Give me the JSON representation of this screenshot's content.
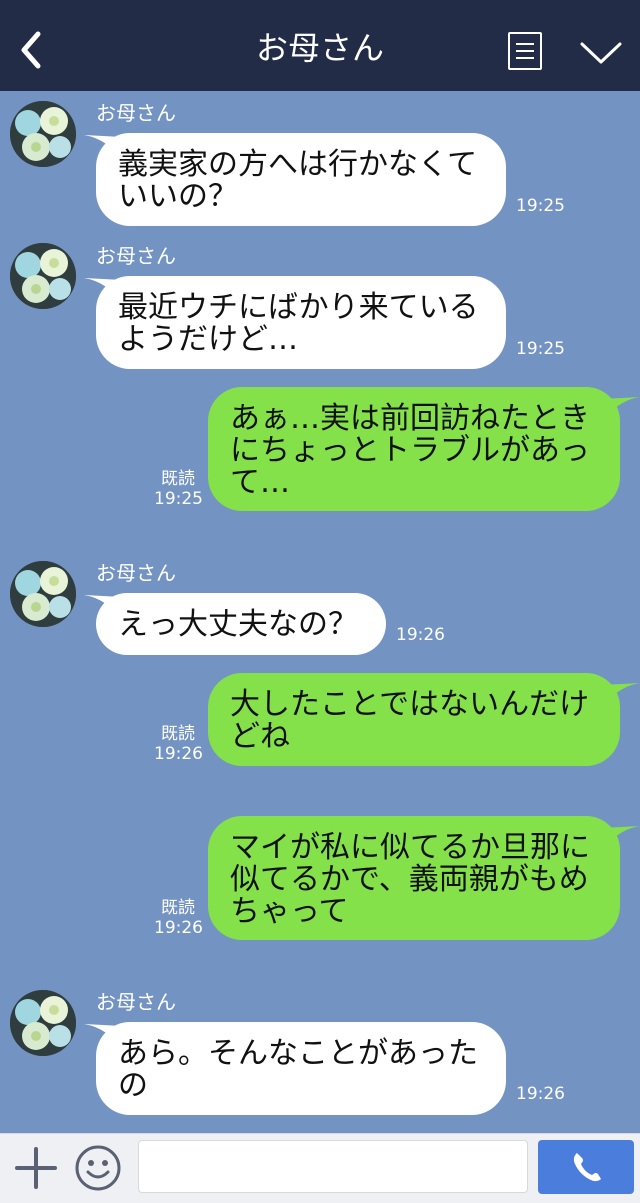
{
  "header": {
    "title": "お母さん"
  },
  "messages": [
    {
      "type": "in",
      "sender": "お母さん",
      "lines": [
        "義実家の方へは行かなくて",
        "いいの？"
      ],
      "time": "19:25"
    },
    {
      "type": "in",
      "sender": "お母さん",
      "lines": [
        "最近ウチにばかり来ている",
        "ようだけど…"
      ],
      "time": "19:25"
    },
    {
      "type": "out",
      "lines": [
        "あぁ…実は前回訪ねたとき",
        "にちょっとトラブルがあっ",
        "て…"
      ],
      "read": "既読",
      "time": "19:25"
    },
    {
      "type": "in",
      "sender": "お母さん",
      "lines": [
        "えっ大丈夫なの？"
      ],
      "time": "19:26"
    },
    {
      "type": "out",
      "lines": [
        "大したことではないんだけ",
        "どね"
      ],
      "read": "既読",
      "time": "19:26"
    },
    {
      "type": "out",
      "lines": [
        "マイが私に似てるか旦那に",
        "似てるかで、義両親がもめ",
        "ちゃって"
      ],
      "read": "既読",
      "time": "19:26"
    },
    {
      "type": "in",
      "sender": "お母さん",
      "lines": [
        "あら。そんなことがあった",
        "の"
      ],
      "time": "19:26"
    }
  ],
  "input": {
    "placeholder": ""
  },
  "icons": {
    "back": "chevron-left-icon",
    "menu": "menu-icon",
    "collapse": "chevron-down-icon",
    "add": "plus-icon",
    "emoji": "smiley-icon",
    "call": "phone-icon"
  },
  "colors": {
    "header": "#232c47",
    "background": "#7393c2",
    "outgoing": "#85e14a",
    "incoming": "#ffffff",
    "call_button": "#4a7ddc"
  }
}
